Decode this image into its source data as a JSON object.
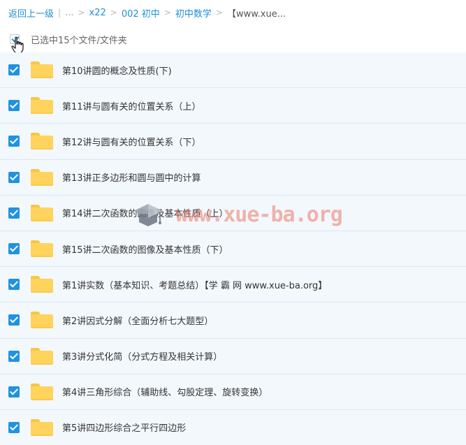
{
  "breadcrumb": {
    "back": "返回上一级",
    "sep_bar": "|",
    "dots": "...",
    "sep": ">",
    "items": [
      "x22",
      "002 初中",
      "初中数学"
    ],
    "current": "【www.xue..."
  },
  "selection": {
    "text": "已选中15个文件/文件夹"
  },
  "files": [
    {
      "name": "第10讲圆的概念及性质(下)"
    },
    {
      "name": "第11讲与圆有关的位置关系（上）"
    },
    {
      "name": "第12讲与圆有关的位置关系（下）"
    },
    {
      "name": "第13讲正多边形和圆与圆中的计算"
    },
    {
      "name": "第14讲二次函数的图像及基本性质（上）"
    },
    {
      "name": "第15讲二次函数的图像及基本性质（下）"
    },
    {
      "name": "第1讲实数（基本知识、考题总结）【学 霸 网 www.xue-ba.org】"
    },
    {
      "name": "第2讲因式分解（全面分析七大题型）"
    },
    {
      "name": "第3讲分式化简（分式方程及相关计算）"
    },
    {
      "name": "第4讲三角形综合（辅助线、勾股定理、旋转变换）"
    },
    {
      "name": "第5讲四边形综合之平行四边形"
    }
  ],
  "watermark": {
    "text": "www.xue-ba.org"
  },
  "colors": {
    "link": "#1e8fd6",
    "checkbox": "#1f93e0",
    "row_bg": "#f3f8fd",
    "folder": "#ffd35c"
  }
}
